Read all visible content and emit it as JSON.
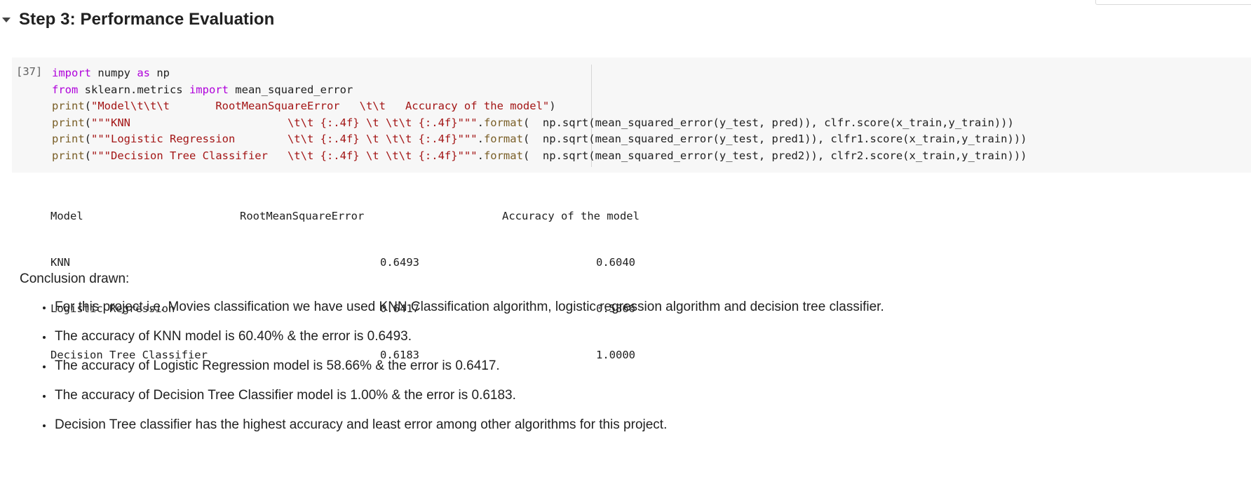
{
  "section": {
    "title": "Step 3: Performance Evaluation"
  },
  "code_cell": {
    "execution_count": "[37]",
    "lines": [
      [
        [
          "kw",
          "import"
        ],
        [
          "plain",
          " numpy "
        ],
        [
          "kw",
          "as"
        ],
        [
          "plain",
          " np"
        ]
      ],
      [
        [
          "kw",
          "from"
        ],
        [
          "plain",
          " sklearn.metrics "
        ],
        [
          "kw",
          "import"
        ],
        [
          "plain",
          " mean_squared_error"
        ]
      ],
      [
        [
          "fn",
          "print"
        ],
        [
          "plain",
          "("
        ],
        [
          "str",
          "\"Model\\t\\t\\t       RootMeanSquareError   \\t\\t   Accuracy of the model\""
        ],
        [
          "plain",
          ")"
        ]
      ],
      [
        [
          "fn",
          "print"
        ],
        [
          "plain",
          "("
        ],
        [
          "str",
          "\"\"\"KNN                        \\t\\t {:.4f} \\t \\t\\t {:.4f}\"\"\""
        ],
        [
          "plain",
          "."
        ],
        [
          "fn",
          "format"
        ],
        [
          "plain",
          "(  np.sqrt(mean_squared_error(y_test, pred)), clfr.score(x_train,y_train)))"
        ]
      ],
      [
        [
          "fn",
          "print"
        ],
        [
          "plain",
          "("
        ],
        [
          "str",
          "\"\"\"Logistic Regression        \\t\\t {:.4f} \\t \\t\\t {:.4f}\"\"\""
        ],
        [
          "plain",
          "."
        ],
        [
          "fn",
          "format"
        ],
        [
          "plain",
          "(  np.sqrt(mean_squared_error(y_test, pred1)), clfr1.score(x_train,y_train)))"
        ]
      ],
      [
        [
          "fn",
          "print"
        ],
        [
          "plain",
          "("
        ],
        [
          "str",
          "\"\"\"Decision Tree Classifier   \\t\\t {:.4f} \\t \\t\\t {:.4f}\"\"\""
        ],
        [
          "plain",
          "."
        ],
        [
          "fn",
          "format"
        ],
        [
          "plain",
          "(  np.sqrt(mean_squared_error(y_test, pred2)), clfr2.score(x_train,y_train)))"
        ]
      ]
    ]
  },
  "output": {
    "header": {
      "model": "Model",
      "rmse": "RootMeanSquareError",
      "accuracy": "Accuracy of the model"
    },
    "rows": [
      {
        "model": "KNN",
        "rmse": "0.6493",
        "accuracy": "0.6040"
      },
      {
        "model": "Logistic Regression",
        "rmse": "0.6417",
        "accuracy": "0.5866"
      },
      {
        "model": "Decision Tree Classifier",
        "rmse": "0.6183",
        "accuracy": "1.0000"
      }
    ]
  },
  "markdown": {
    "conclusion_title": "Conclusion drawn:",
    "bullets": [
      "For this project i.e. Movies classification we have used KNN Classification algorithm, logistic regression algorithm and decision tree classifier.",
      "The accuracy of KNN model is 60.40% & the error is 0.6493.",
      "The accuracy of Logistic Regression model is 58.66% & the error is 0.6417.",
      "The accuracy of Decision Tree Classifier model is 1.00% & the error is 0.6183.",
      "Decision Tree classifier has the highest accuracy and least error among other algorithms for this project."
    ]
  },
  "colors": {
    "keyword": "#af00db",
    "string": "#a31515",
    "function": "#795e26",
    "code_background": "#f7f7f7"
  },
  "icons": {
    "collapse": "caret-down-icon"
  }
}
